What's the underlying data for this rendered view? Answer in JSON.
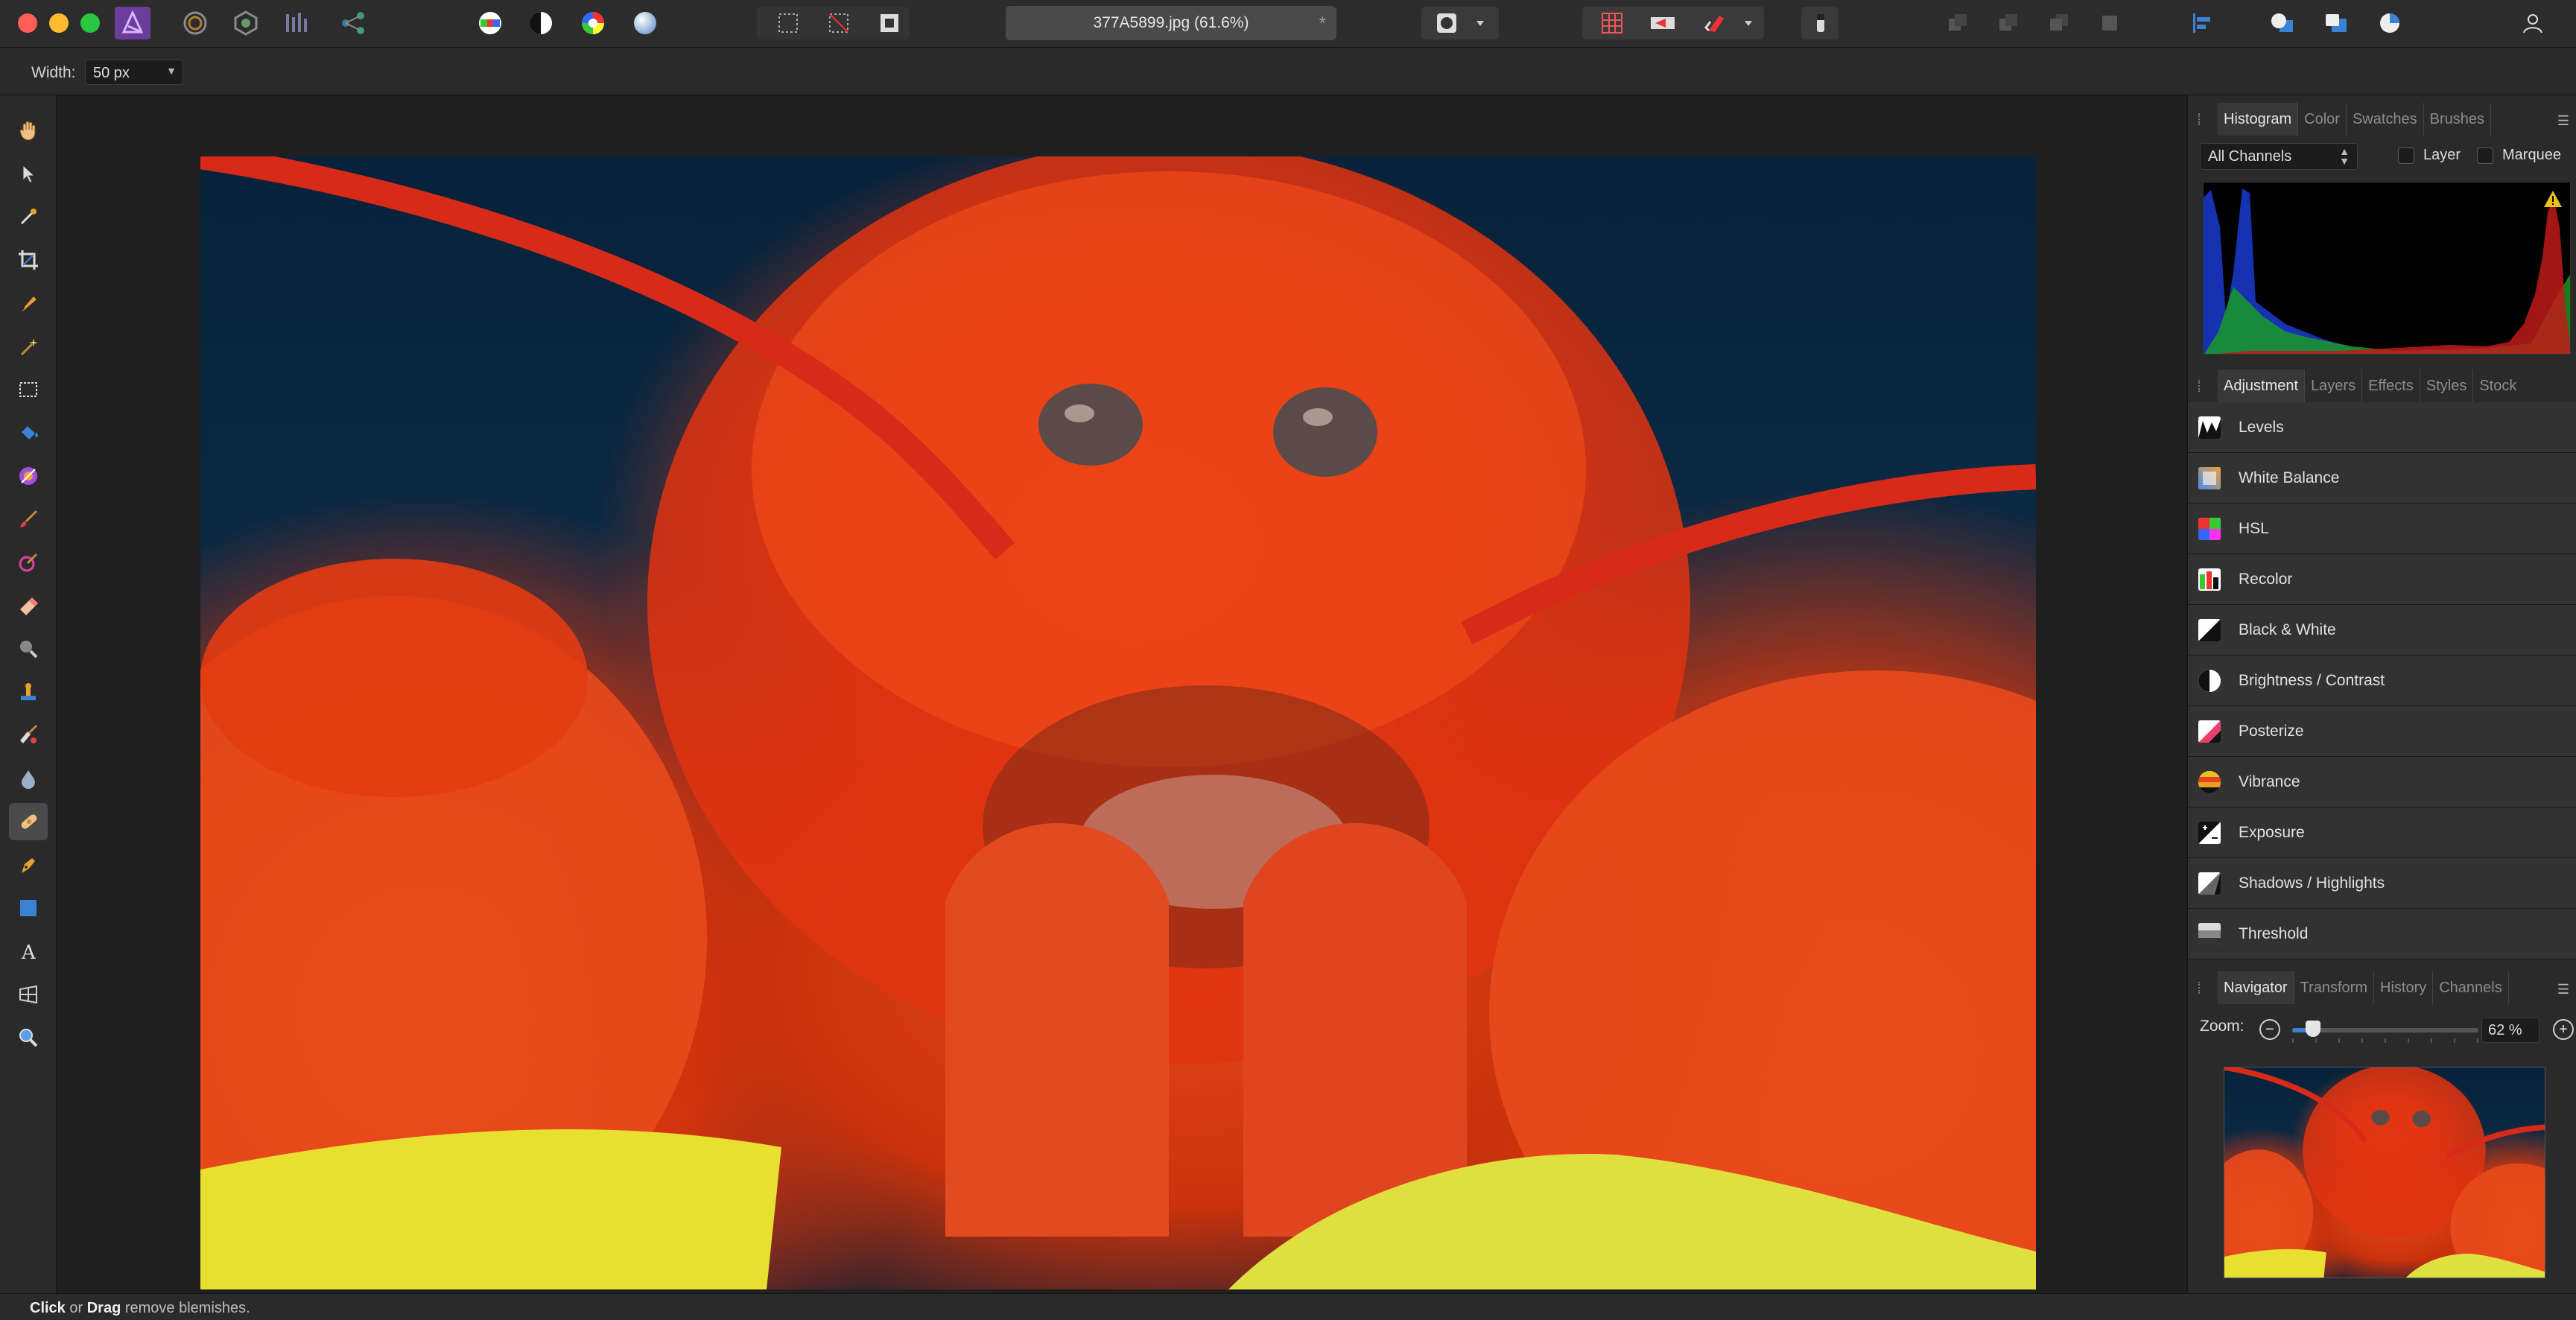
{
  "app": {
    "name": "Affinity Photo",
    "persona": "Photo Persona",
    "accent": "#a455e8"
  },
  "toolbar": {
    "document_title": "377A5899.jpg (61.6%)",
    "modified_marker": "*",
    "personas": [
      "photo-persona-icon",
      "liquify-persona-icon",
      "develop-persona-icon",
      "tone-mapping-persona-icon",
      "export-persona-icon"
    ],
    "icons": [
      "auto-levels-icon",
      "auto-contrast-icon",
      "auto-colors-icon",
      "auto-white-balance-icon",
      "marquee-icon",
      "deselect-icon",
      "invert-selection-icon",
      "quick-mask-icon",
      "snapping-icon",
      "order-icons",
      "align-icon",
      "boolean-icons",
      "user-icon"
    ]
  },
  "context": {
    "width_label": "Width:",
    "width_value": "50 px"
  },
  "tools": [
    "view-hand-icon",
    "move-arrow-icon",
    "color-picker-icon",
    "crop-icon",
    "selection-brush-icon",
    "magic-wand-icon",
    "rectangle-marquee-icon",
    "flood-fill-icon",
    "gradient-icon",
    "paint-brush-icon",
    "color-replacement-icon",
    "erase-brush-icon",
    "dodge-icon",
    "clone-brush-icon",
    "blemish-brush-icon",
    "blur-brush-icon",
    "inpainting-brush-icon",
    "pen-icon",
    "rectangle-shape-icon",
    "text-icon",
    "mesh-warp-icon",
    "zoom-icon"
  ],
  "panel": {
    "histogram_tabs": [
      "Histogram",
      "Color",
      "Swatches",
      "Brushes"
    ],
    "channels_value": "All Channels",
    "layer_checkbox": "Layer",
    "marquee_checkbox": "Marquee",
    "adjustment_tabs": [
      "Adjustment",
      "Layers",
      "Effects",
      "Styles",
      "Stock"
    ],
    "adjustments": [
      {
        "label": "Levels",
        "icon": "levels-icon"
      },
      {
        "label": "White Balance",
        "icon": "white-balance-icon"
      },
      {
        "label": "HSL",
        "icon": "hsl-icon"
      },
      {
        "label": "Recolor",
        "icon": "recolor-icon"
      },
      {
        "label": "Black & White",
        "icon": "black-white-icon"
      },
      {
        "label": "Brightness / Contrast",
        "icon": "brightness-contrast-icon"
      },
      {
        "label": "Posterize",
        "icon": "posterize-icon"
      },
      {
        "label": "Vibrance",
        "icon": "vibrance-icon"
      },
      {
        "label": "Exposure",
        "icon": "exposure-icon"
      },
      {
        "label": "Shadows / Highlights",
        "icon": "shadows-highlights-icon"
      },
      {
        "label": "Threshold",
        "icon": "threshold-icon"
      }
    ],
    "navigator_tabs": [
      "Navigator",
      "Transform",
      "History",
      "Channels"
    ],
    "zoom_label": "Zoom:",
    "zoom_value": "62 %",
    "zoom_slider_fraction": 0.11
  },
  "status": {
    "click": "Click",
    "or": " or ",
    "drag": "Drag",
    "rest": " remove blemishes."
  }
}
